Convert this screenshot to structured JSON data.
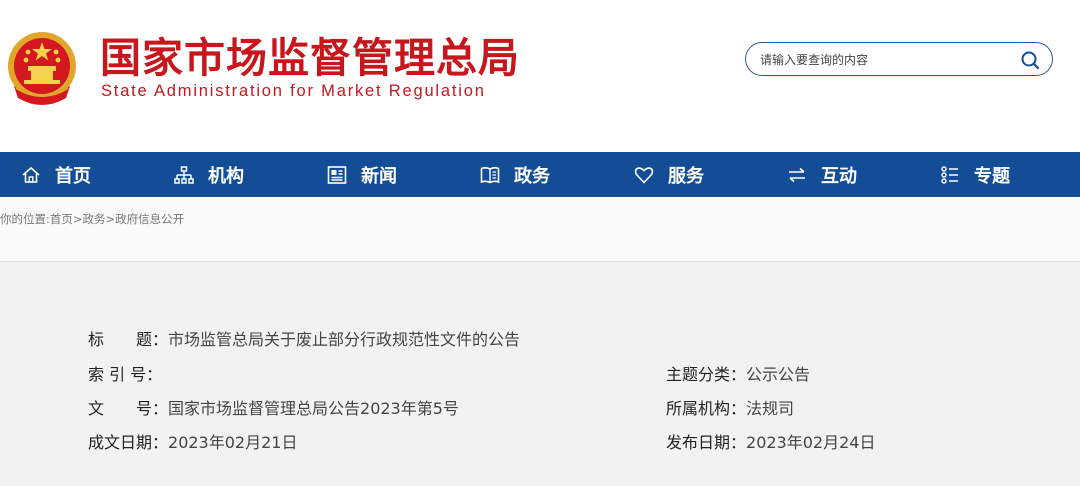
{
  "header": {
    "title_cn": "国家市场监督管理总局",
    "title_en": "State Administration for Market Regulation",
    "emblem_icon": "national-emblem-icon"
  },
  "search": {
    "placeholder": "请输入要查询的内容",
    "icon": "search-icon"
  },
  "nav": {
    "items": [
      {
        "label": "首页",
        "icon": "home-icon"
      },
      {
        "label": "机构",
        "icon": "org-chart-icon"
      },
      {
        "label": "新闻",
        "icon": "newspaper-icon"
      },
      {
        "label": "政务",
        "icon": "book-icon"
      },
      {
        "label": "服务",
        "icon": "heart-icon"
      },
      {
        "label": "互动",
        "icon": "exchange-arrows-icon"
      },
      {
        "label": "专题",
        "icon": "list-icon"
      }
    ]
  },
  "breadcrumb": {
    "prefix": "你的位置:",
    "items": [
      "首页",
      "政务",
      "政府信息公开"
    ],
    "separator": ">"
  },
  "info": {
    "title_key": "标　　题：",
    "title_value": "市场监管总局关于废止部分行政规范性文件的公告",
    "index_key": "索 引 号：",
    "index_value": "",
    "category_key": "主题分类：",
    "category_value": "公示公告",
    "docno_key": "文　　号：",
    "docno_value": "国家市场监督管理总局公告2023年第5号",
    "agency_key": "所属机构：",
    "agency_value": "法规司",
    "created_key": "成文日期：",
    "created_value": "2023年02月21日",
    "published_key": "发布日期：",
    "published_value": "2023年02月24日"
  },
  "colors": {
    "brand_red": "#c8161d",
    "nav_blue": "#134d96",
    "search_border": "#2a5a9e"
  }
}
